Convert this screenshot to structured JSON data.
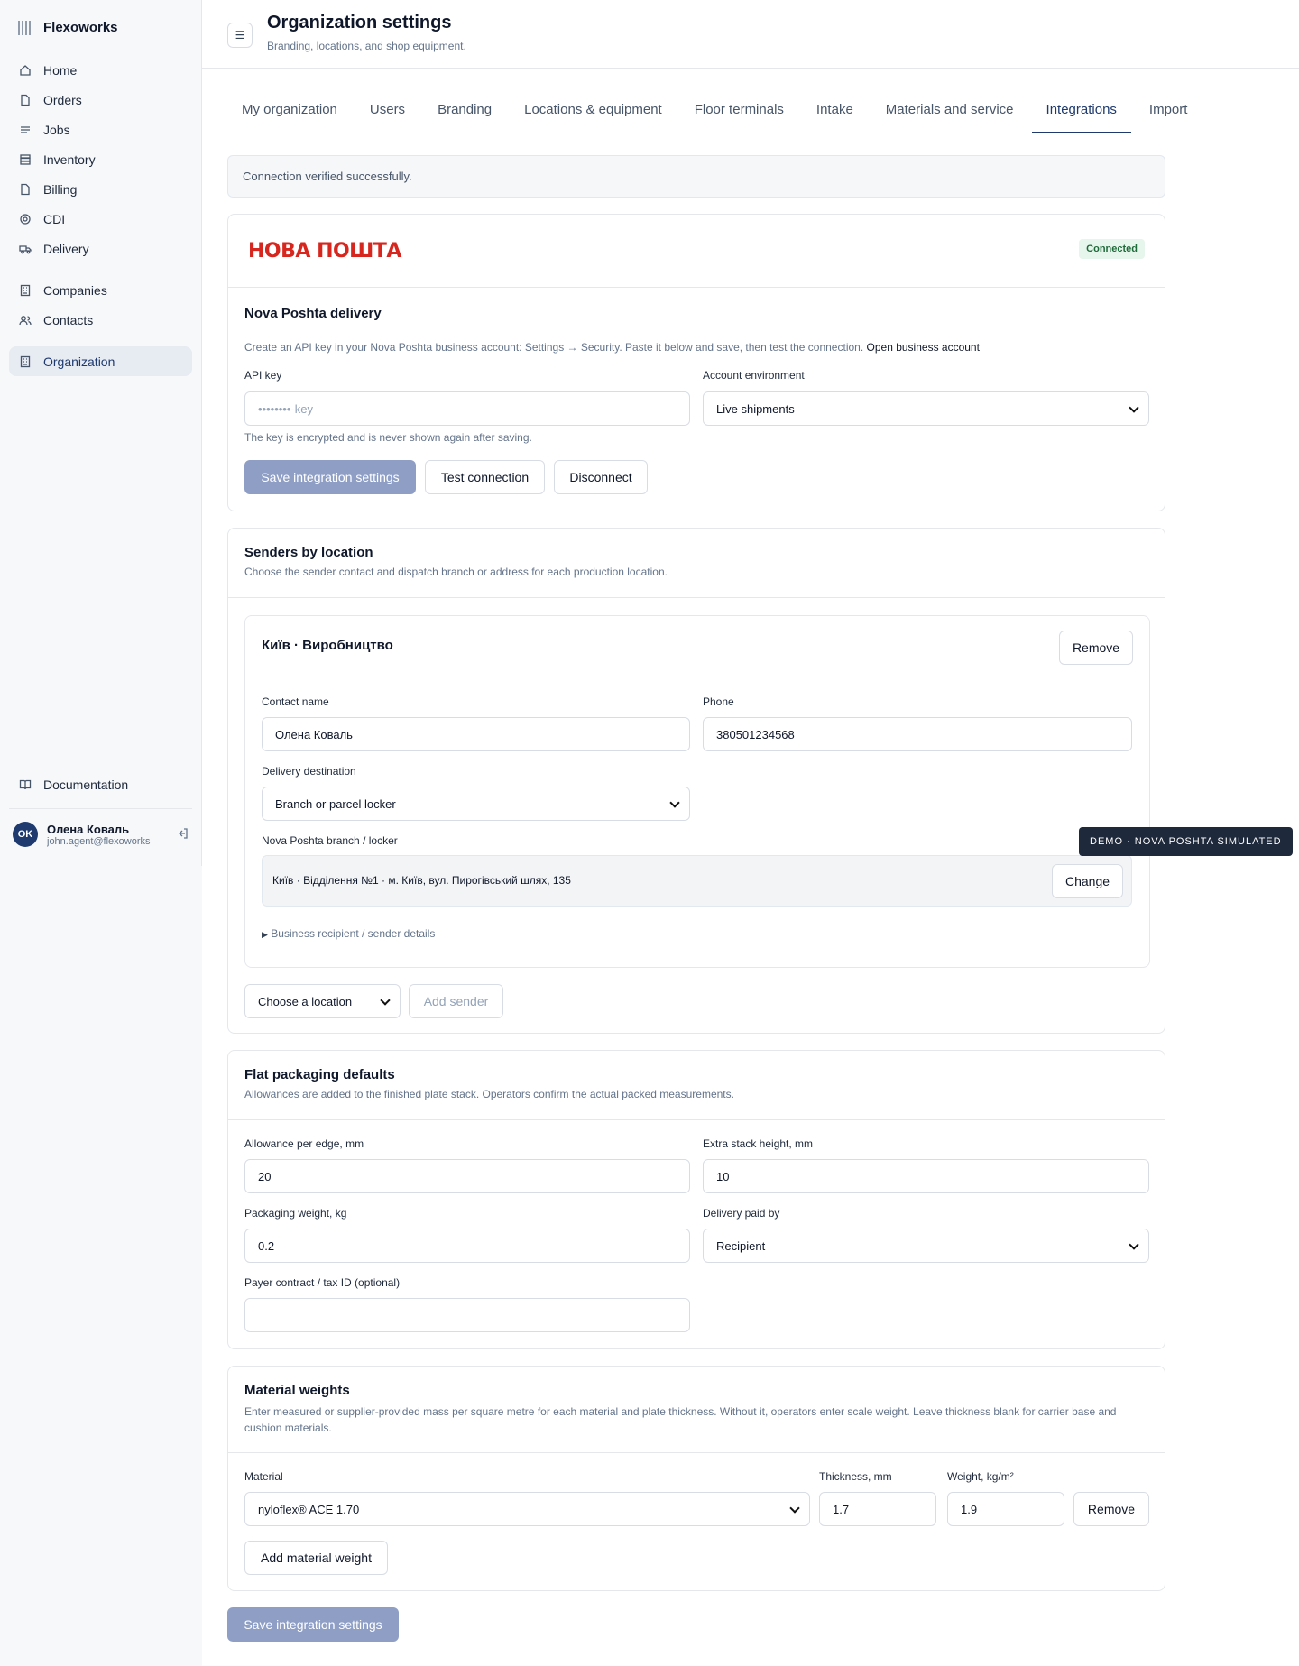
{
  "app": {
    "name": "Flexoworks"
  },
  "sidebar": {
    "items": [
      {
        "label": "Home",
        "icon": "home-icon"
      },
      {
        "label": "Orders",
        "icon": "file-icon"
      },
      {
        "label": "Jobs",
        "icon": "list-icon"
      },
      {
        "label": "Inventory",
        "icon": "stack-icon"
      },
      {
        "label": "Billing",
        "icon": "receipt-icon"
      },
      {
        "label": "CDI",
        "icon": "target-icon"
      },
      {
        "label": "Delivery",
        "icon": "truck-icon"
      }
    ],
    "secondary": [
      {
        "label": "Companies",
        "icon": "building-icon"
      },
      {
        "label": "Contacts",
        "icon": "users-icon"
      }
    ],
    "active": {
      "label": "Organization",
      "icon": "organization-icon"
    },
    "documentation": "Documentation",
    "user": {
      "initials": "OK",
      "name": "Олена Коваль",
      "email": "john.agent@flexoworks"
    }
  },
  "header": {
    "title": "Organization settings",
    "subtitle": "Branding, locations, and shop equipment."
  },
  "tabs": [
    {
      "label": "My organization"
    },
    {
      "label": "Users"
    },
    {
      "label": "Branding"
    },
    {
      "label": "Locations & equipment"
    },
    {
      "label": "Floor terminals"
    },
    {
      "label": "Intake"
    },
    {
      "label": "Materials and service"
    },
    {
      "label": "Integrations",
      "active": true
    },
    {
      "label": "Import"
    }
  ],
  "alert": "Connection verified successfully.",
  "integration": {
    "logo_text": "НОВА ПОШТА",
    "status": "Connected",
    "title": "Nova Poshta delivery",
    "description": "Create an API key in your Nova Poshta business account: Settings → Security. Paste it below and save, then test the connection.",
    "open_account_link": "Open business account",
    "api_key_label": "API key",
    "api_key_placeholder": "••••••••-key",
    "api_key_help": "The key is encrypted and is never shown again after saving.",
    "env_label": "Account environment",
    "env_value": "Live shipments",
    "save_button": "Save integration settings",
    "test_button": "Test connection",
    "disconnect_button": "Disconnect"
  },
  "senders": {
    "title": "Senders by location",
    "description": "Choose the sender contact and dispatch branch or address for each production location.",
    "sender": {
      "location": "Київ · Виробництво",
      "remove_button": "Remove",
      "contact_label": "Contact name",
      "contact_value": "Олена Коваль",
      "phone_label": "Phone",
      "phone_value": "380501234568",
      "destination_label": "Delivery destination",
      "destination_value": "Branch or parcel locker",
      "branch_label": "Nova Poshta branch / locker",
      "branch_value": "Київ · Відділення №1 · м. Київ, вул. Пирогівський шлях, 135",
      "change_button": "Change",
      "details_toggle": "Business recipient / sender details"
    },
    "location_select": "Choose a location",
    "add_sender_button": "Add sender"
  },
  "tooltip": "DEMO · NOVA POSHTA SIMULATED",
  "packaging": {
    "title": "Flat packaging defaults",
    "description": "Allowances are added to the finished plate stack. Operators confirm the actual packed measurements.",
    "allowance_label": "Allowance per edge, mm",
    "allowance_value": "20",
    "extra_height_label": "Extra stack height, mm",
    "extra_height_value": "10",
    "weight_label": "Packaging weight, kg",
    "weight_value": "0.2",
    "paid_by_label": "Delivery paid by",
    "paid_by_value": "Recipient",
    "payer_label": "Payer contract / tax ID (optional)",
    "payer_value": ""
  },
  "materials": {
    "title": "Material weights",
    "description": "Enter measured or supplier-provided mass per square metre for each material and plate thickness. Without it, operators enter scale weight. Leave thickness blank for carrier base and cushion materials.",
    "material_label": "Material",
    "material_value": "nyloflex® ACE 1.70",
    "thickness_label": "Thickness, mm",
    "thickness_value": "1.7",
    "weight_label": "Weight, kg/m²",
    "weight_value": "1.9",
    "remove_button": "Remove",
    "add_button": "Add material weight"
  },
  "footer_save": "Save integration settings"
}
